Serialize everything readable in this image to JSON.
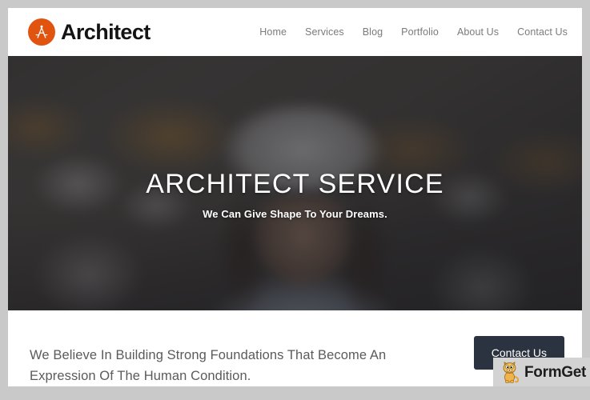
{
  "window": {
    "frame_color": "#c9c9c9",
    "page_background": "#ffffff"
  },
  "header": {
    "brand": {
      "icon": "compass-divider-icon",
      "icon_color": "#e1540f",
      "name": "Architect"
    },
    "nav": [
      {
        "label": "Home"
      },
      {
        "label": "Services"
      },
      {
        "label": "Blog"
      },
      {
        "label": "Portfolio"
      },
      {
        "label": "About Us"
      },
      {
        "label": "Contact Us"
      }
    ]
  },
  "hero": {
    "title": "ARCHITECT SERVICE",
    "subtitle": "We Can Give Shape To Your Dreams.",
    "image_description": "Blurred construction site with a woman wearing a white hard hat in the foreground",
    "overlay_color": "#222124",
    "text_color": "#ffffff"
  },
  "intro": {
    "text": "We Believe In Building Strong Foundations That Become An Expression Of The Human Condition.",
    "button_label": "Contact Us",
    "button_color": "#2b3340",
    "text_color": "#5b5b5b"
  },
  "watermark": {
    "label": "FormGet",
    "icon": "cat-mascot-icon",
    "background": "#d3d3d3"
  }
}
